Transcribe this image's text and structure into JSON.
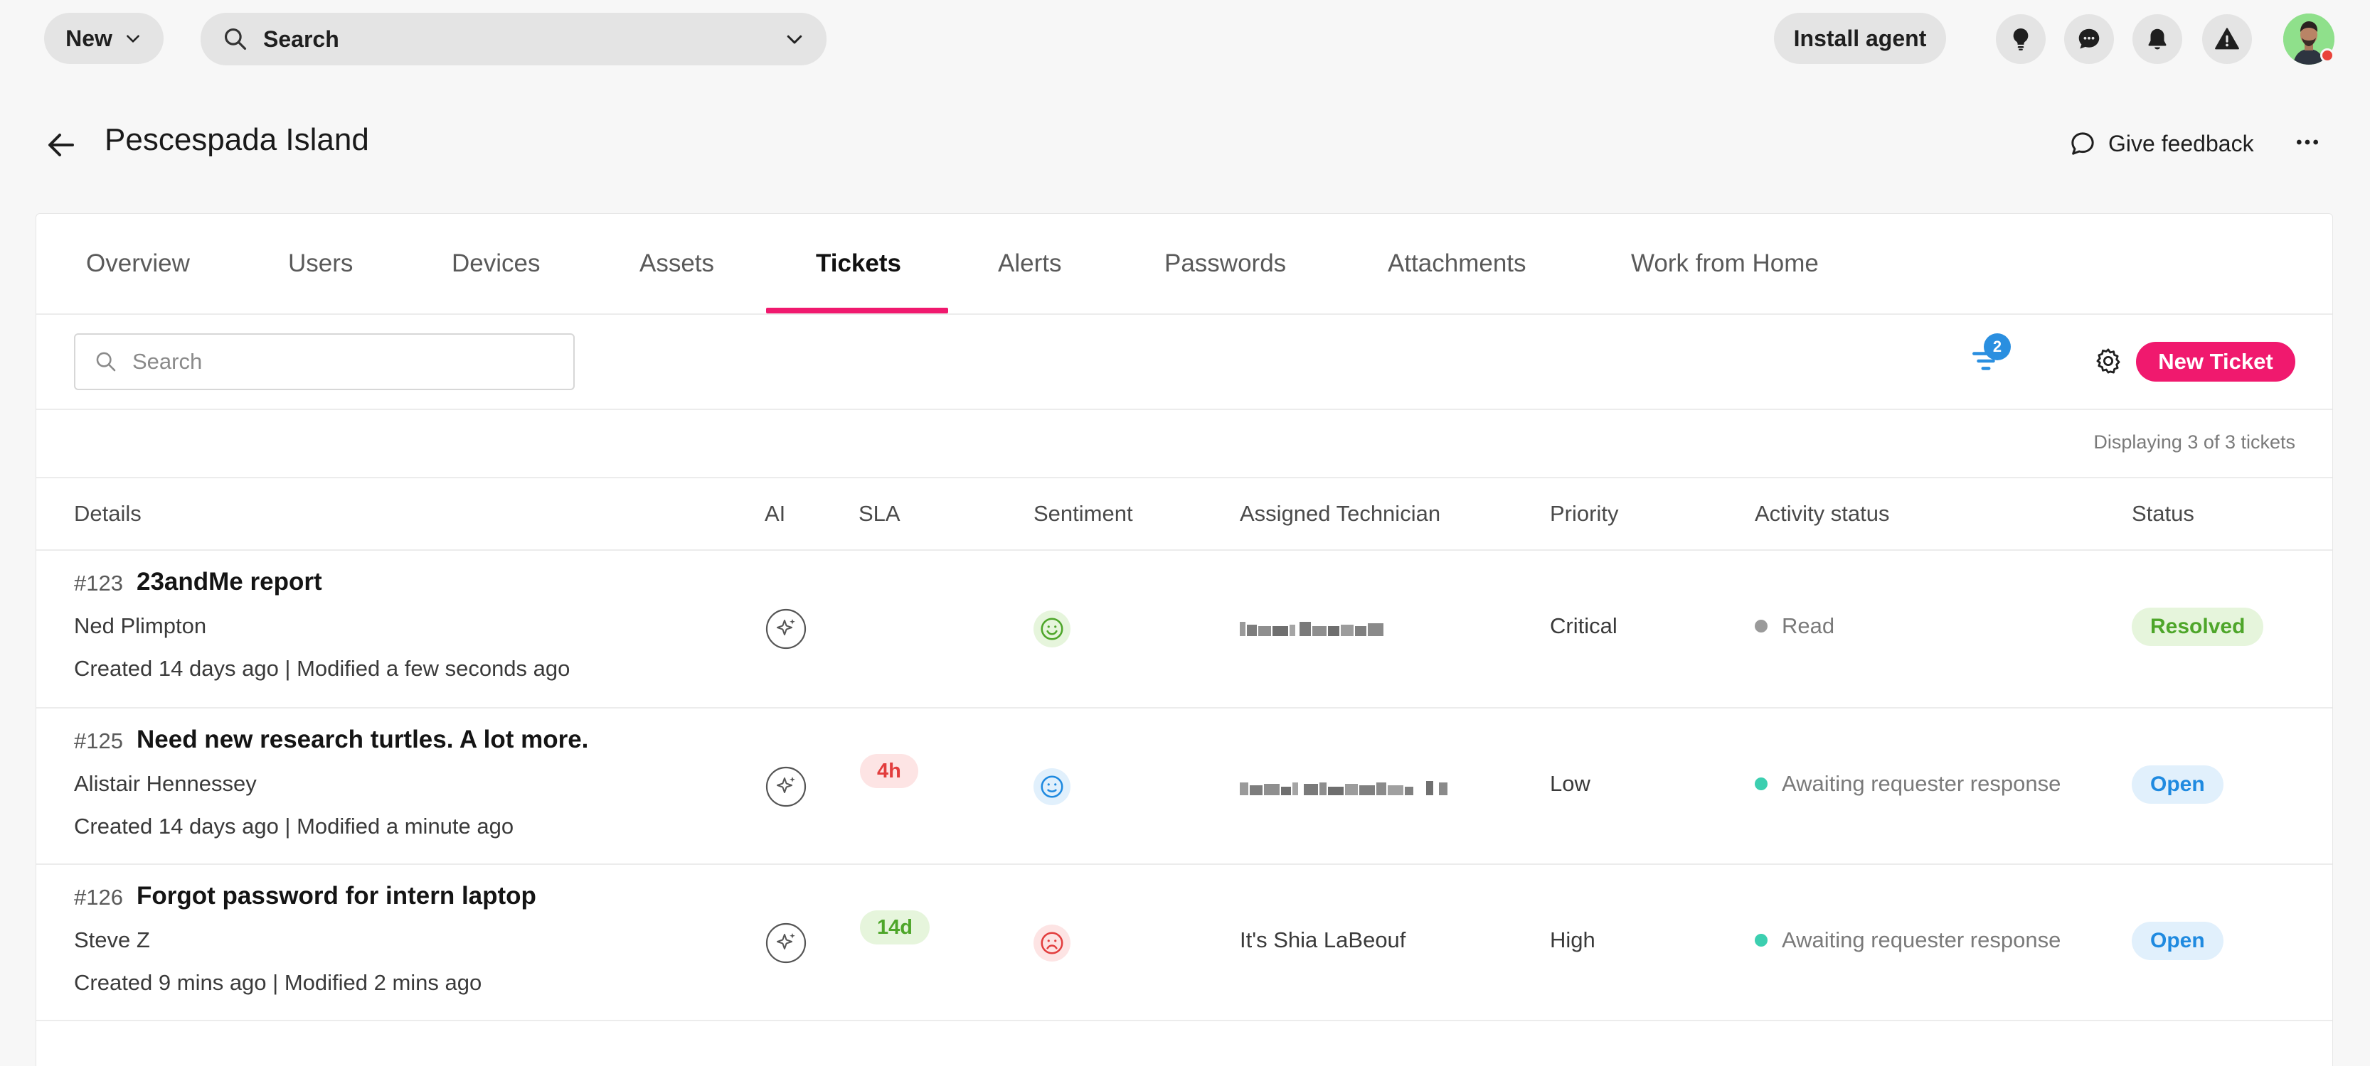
{
  "topbar": {
    "new_label": "New",
    "search_label": "Search",
    "install_label": "Install agent"
  },
  "header": {
    "title": "Pescespada Island",
    "feedback_label": "Give feedback"
  },
  "tabs": [
    {
      "label": "Overview"
    },
    {
      "label": "Users"
    },
    {
      "label": "Devices"
    },
    {
      "label": "Assets"
    },
    {
      "label": "Tickets"
    },
    {
      "label": "Alerts"
    },
    {
      "label": "Passwords"
    },
    {
      "label": "Attachments"
    },
    {
      "label": "Work from Home"
    }
  ],
  "toolbar": {
    "search_placeholder": "Search",
    "filter_count": "2",
    "new_ticket_label": "New Ticket",
    "display_count": "Displaying 3 of 3 tickets"
  },
  "columns": {
    "details": "Details",
    "ai": "AI",
    "sla": "SLA",
    "sentiment": "Sentiment",
    "technician": "Assigned Technician",
    "priority": "Priority",
    "activity": "Activity status",
    "status": "Status"
  },
  "tickets": [
    {
      "id": "#123",
      "title": "23andMe report",
      "requester": "Ned Plimpton",
      "dates": "Created 14 days ago | Modified a few seconds ago",
      "sla": "",
      "sentiment": "happy",
      "technician": "",
      "priority": "Critical",
      "activity": "Read",
      "activity_color": "#9a9a9a",
      "status": "Resolved"
    },
    {
      "id": "#125",
      "title": "Need new research turtles. A lot more.",
      "requester": "Alistair Hennessey",
      "dates": "Created 14 days ago | Modified a minute ago",
      "sla": "4h",
      "sentiment": "neutral",
      "technician": "",
      "priority": "Low",
      "activity": "Awaiting requester response",
      "activity_color": "#3ccfb0",
      "status": "Open"
    },
    {
      "id": "#126",
      "title": "Forgot password for intern laptop",
      "requester": "Steve Z",
      "dates": "Created 9 mins ago | Modified 2 mins ago",
      "sla": "14d",
      "sentiment": "sad",
      "technician": "It's Shia LaBeouf",
      "priority": "High",
      "activity": "Awaiting requester response",
      "activity_color": "#3ccfb0",
      "status": "Open"
    }
  ],
  "colors": {
    "accent": "#f0196e",
    "badge_blue": "#2a8fe0",
    "resolved_green": "#4ea62a",
    "open_blue": "#1f8ae0"
  },
  "icons": [
    "chevron-down-icon",
    "search-icon",
    "lightbulb-icon",
    "chat-icon",
    "bell-icon",
    "warning-icon",
    "back-arrow-icon",
    "feedback-icon",
    "more-icon",
    "filter-icon",
    "gear-icon",
    "ai-sparkle-icon",
    "smiley-icon"
  ]
}
